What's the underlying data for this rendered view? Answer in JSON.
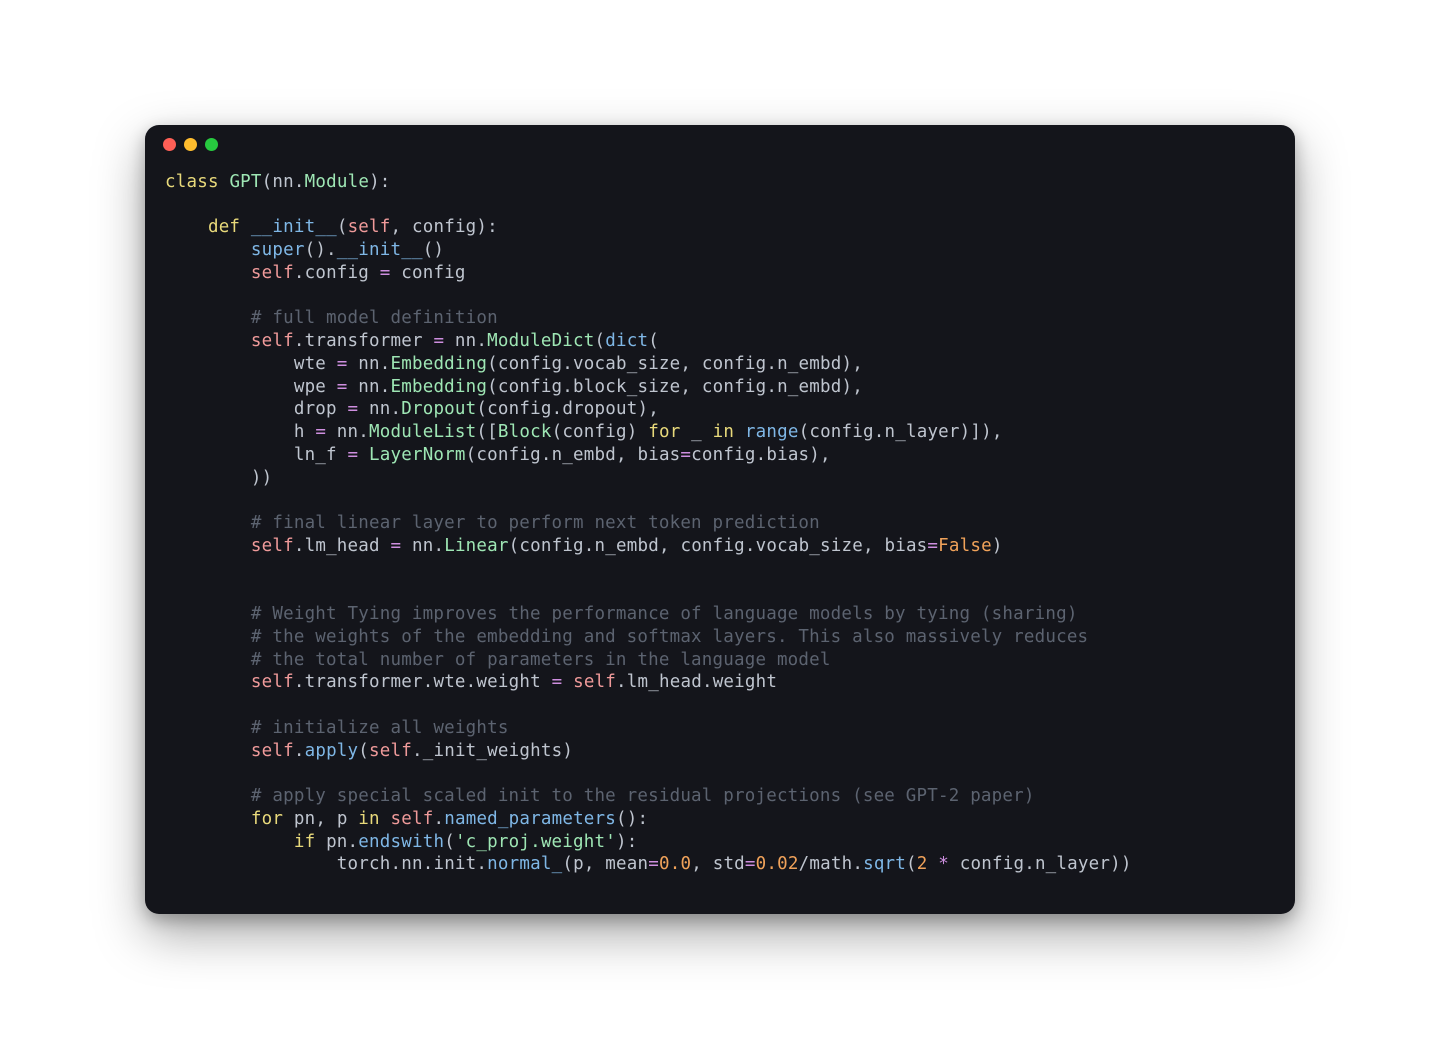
{
  "window": {
    "traffic_lights": [
      "close",
      "minimize",
      "zoom"
    ]
  },
  "code": {
    "lines": [
      [
        {
          "c": "tok-kw",
          "t": "class"
        },
        {
          "c": "tok-ident",
          "t": " "
        },
        {
          "c": "tok-cls",
          "t": "GPT"
        },
        {
          "c": "tok-punct",
          "t": "("
        },
        {
          "c": "tok-ident",
          "t": "nn"
        },
        {
          "c": "tok-punct",
          "t": "."
        },
        {
          "c": "tok-cls",
          "t": "Module"
        },
        {
          "c": "tok-punct",
          "t": "):"
        }
      ],
      [],
      [
        {
          "c": "tok-ident",
          "t": "    "
        },
        {
          "c": "tok-kw",
          "t": "def"
        },
        {
          "c": "tok-ident",
          "t": " "
        },
        {
          "c": "tok-func",
          "t": "__init__"
        },
        {
          "c": "tok-punct",
          "t": "("
        },
        {
          "c": "tok-self",
          "t": "self"
        },
        {
          "c": "tok-punct",
          "t": ", "
        },
        {
          "c": "tok-ident",
          "t": "config"
        },
        {
          "c": "tok-punct",
          "t": "):"
        }
      ],
      [
        {
          "c": "tok-ident",
          "t": "        "
        },
        {
          "c": "tok-func",
          "t": "super"
        },
        {
          "c": "tok-punct",
          "t": "()."
        },
        {
          "c": "tok-func",
          "t": "__init__"
        },
        {
          "c": "tok-punct",
          "t": "()"
        }
      ],
      [
        {
          "c": "tok-ident",
          "t": "        "
        },
        {
          "c": "tok-self",
          "t": "self"
        },
        {
          "c": "tok-punct",
          "t": "."
        },
        {
          "c": "tok-ident",
          "t": "config "
        },
        {
          "c": "tok-op",
          "t": "="
        },
        {
          "c": "tok-ident",
          "t": " config"
        }
      ],
      [],
      [
        {
          "c": "tok-ident",
          "t": "        "
        },
        {
          "c": "tok-cmt",
          "t": "# full model definition"
        }
      ],
      [
        {
          "c": "tok-ident",
          "t": "        "
        },
        {
          "c": "tok-self",
          "t": "self"
        },
        {
          "c": "tok-punct",
          "t": "."
        },
        {
          "c": "tok-ident",
          "t": "transformer "
        },
        {
          "c": "tok-op",
          "t": "="
        },
        {
          "c": "tok-ident",
          "t": " nn"
        },
        {
          "c": "tok-punct",
          "t": "."
        },
        {
          "c": "tok-cls",
          "t": "ModuleDict"
        },
        {
          "c": "tok-punct",
          "t": "("
        },
        {
          "c": "tok-func",
          "t": "dict"
        },
        {
          "c": "tok-punct",
          "t": "("
        }
      ],
      [
        {
          "c": "tok-ident",
          "t": "            wte "
        },
        {
          "c": "tok-op",
          "t": "="
        },
        {
          "c": "tok-ident",
          "t": " nn"
        },
        {
          "c": "tok-punct",
          "t": "."
        },
        {
          "c": "tok-cls",
          "t": "Embedding"
        },
        {
          "c": "tok-punct",
          "t": "("
        },
        {
          "c": "tok-ident",
          "t": "config"
        },
        {
          "c": "tok-punct",
          "t": "."
        },
        {
          "c": "tok-ident",
          "t": "vocab_size"
        },
        {
          "c": "tok-punct",
          "t": ", "
        },
        {
          "c": "tok-ident",
          "t": "config"
        },
        {
          "c": "tok-punct",
          "t": "."
        },
        {
          "c": "tok-ident",
          "t": "n_embd"
        },
        {
          "c": "tok-punct",
          "t": "),"
        }
      ],
      [
        {
          "c": "tok-ident",
          "t": "            wpe "
        },
        {
          "c": "tok-op",
          "t": "="
        },
        {
          "c": "tok-ident",
          "t": " nn"
        },
        {
          "c": "tok-punct",
          "t": "."
        },
        {
          "c": "tok-cls",
          "t": "Embedding"
        },
        {
          "c": "tok-punct",
          "t": "("
        },
        {
          "c": "tok-ident",
          "t": "config"
        },
        {
          "c": "tok-punct",
          "t": "."
        },
        {
          "c": "tok-ident",
          "t": "block_size"
        },
        {
          "c": "tok-punct",
          "t": ", "
        },
        {
          "c": "tok-ident",
          "t": "config"
        },
        {
          "c": "tok-punct",
          "t": "."
        },
        {
          "c": "tok-ident",
          "t": "n_embd"
        },
        {
          "c": "tok-punct",
          "t": "),"
        }
      ],
      [
        {
          "c": "tok-ident",
          "t": "            drop "
        },
        {
          "c": "tok-op",
          "t": "="
        },
        {
          "c": "tok-ident",
          "t": " nn"
        },
        {
          "c": "tok-punct",
          "t": "."
        },
        {
          "c": "tok-cls",
          "t": "Dropout"
        },
        {
          "c": "tok-punct",
          "t": "("
        },
        {
          "c": "tok-ident",
          "t": "config"
        },
        {
          "c": "tok-punct",
          "t": "."
        },
        {
          "c": "tok-ident",
          "t": "dropout"
        },
        {
          "c": "tok-punct",
          "t": "),"
        }
      ],
      [
        {
          "c": "tok-ident",
          "t": "            h "
        },
        {
          "c": "tok-op",
          "t": "="
        },
        {
          "c": "tok-ident",
          "t": " nn"
        },
        {
          "c": "tok-punct",
          "t": "."
        },
        {
          "c": "tok-cls",
          "t": "ModuleList"
        },
        {
          "c": "tok-punct",
          "t": "(["
        },
        {
          "c": "tok-cls",
          "t": "Block"
        },
        {
          "c": "tok-punct",
          "t": "("
        },
        {
          "c": "tok-ident",
          "t": "config"
        },
        {
          "c": "tok-punct",
          "t": ") "
        },
        {
          "c": "tok-kw",
          "t": "for"
        },
        {
          "c": "tok-ident",
          "t": " _ "
        },
        {
          "c": "tok-kw",
          "t": "in"
        },
        {
          "c": "tok-ident",
          "t": " "
        },
        {
          "c": "tok-func",
          "t": "range"
        },
        {
          "c": "tok-punct",
          "t": "("
        },
        {
          "c": "tok-ident",
          "t": "config"
        },
        {
          "c": "tok-punct",
          "t": "."
        },
        {
          "c": "tok-ident",
          "t": "n_layer"
        },
        {
          "c": "tok-punct",
          "t": ")]),"
        }
      ],
      [
        {
          "c": "tok-ident",
          "t": "            ln_f "
        },
        {
          "c": "tok-op",
          "t": "="
        },
        {
          "c": "tok-ident",
          "t": " "
        },
        {
          "c": "tok-cls",
          "t": "LayerNorm"
        },
        {
          "c": "tok-punct",
          "t": "("
        },
        {
          "c": "tok-ident",
          "t": "config"
        },
        {
          "c": "tok-punct",
          "t": "."
        },
        {
          "c": "tok-ident",
          "t": "n_embd"
        },
        {
          "c": "tok-punct",
          "t": ", "
        },
        {
          "c": "tok-ident",
          "t": "bias"
        },
        {
          "c": "tok-op",
          "t": "="
        },
        {
          "c": "tok-ident",
          "t": "config"
        },
        {
          "c": "tok-punct",
          "t": "."
        },
        {
          "c": "tok-ident",
          "t": "bias"
        },
        {
          "c": "tok-punct",
          "t": "),"
        }
      ],
      [
        {
          "c": "tok-ident",
          "t": "        "
        },
        {
          "c": "tok-punct",
          "t": "))"
        }
      ],
      [],
      [
        {
          "c": "tok-ident",
          "t": "        "
        },
        {
          "c": "tok-cmt",
          "t": "# final linear layer to perform next token prediction"
        }
      ],
      [
        {
          "c": "tok-ident",
          "t": "        "
        },
        {
          "c": "tok-self",
          "t": "self"
        },
        {
          "c": "tok-punct",
          "t": "."
        },
        {
          "c": "tok-ident",
          "t": "lm_head "
        },
        {
          "c": "tok-op",
          "t": "="
        },
        {
          "c": "tok-ident",
          "t": " nn"
        },
        {
          "c": "tok-punct",
          "t": "."
        },
        {
          "c": "tok-cls",
          "t": "Linear"
        },
        {
          "c": "tok-punct",
          "t": "("
        },
        {
          "c": "tok-ident",
          "t": "config"
        },
        {
          "c": "tok-punct",
          "t": "."
        },
        {
          "c": "tok-ident",
          "t": "n_embd"
        },
        {
          "c": "tok-punct",
          "t": ", "
        },
        {
          "c": "tok-ident",
          "t": "config"
        },
        {
          "c": "tok-punct",
          "t": "."
        },
        {
          "c": "tok-ident",
          "t": "vocab_size"
        },
        {
          "c": "tok-punct",
          "t": ", "
        },
        {
          "c": "tok-ident",
          "t": "bias"
        },
        {
          "c": "tok-op",
          "t": "="
        },
        {
          "c": "tok-const",
          "t": "False"
        },
        {
          "c": "tok-punct",
          "t": ")"
        }
      ],
      [],
      [],
      [
        {
          "c": "tok-ident",
          "t": "        "
        },
        {
          "c": "tok-cmt",
          "t": "# Weight Tying improves the performance of language models by tying (sharing)"
        }
      ],
      [
        {
          "c": "tok-ident",
          "t": "        "
        },
        {
          "c": "tok-cmt",
          "t": "# the weights of the embedding and softmax layers. This also massively reduces"
        }
      ],
      [
        {
          "c": "tok-ident",
          "t": "        "
        },
        {
          "c": "tok-cmt",
          "t": "# the total number of parameters in the language model"
        }
      ],
      [
        {
          "c": "tok-ident",
          "t": "        "
        },
        {
          "c": "tok-self",
          "t": "self"
        },
        {
          "c": "tok-punct",
          "t": "."
        },
        {
          "c": "tok-ident",
          "t": "transformer"
        },
        {
          "c": "tok-punct",
          "t": "."
        },
        {
          "c": "tok-ident",
          "t": "wte"
        },
        {
          "c": "tok-punct",
          "t": "."
        },
        {
          "c": "tok-ident",
          "t": "weight "
        },
        {
          "c": "tok-op",
          "t": "="
        },
        {
          "c": "tok-ident",
          "t": " "
        },
        {
          "c": "tok-self",
          "t": "self"
        },
        {
          "c": "tok-punct",
          "t": "."
        },
        {
          "c": "tok-ident",
          "t": "lm_head"
        },
        {
          "c": "tok-punct",
          "t": "."
        },
        {
          "c": "tok-ident",
          "t": "weight"
        }
      ],
      [],
      [
        {
          "c": "tok-ident",
          "t": "        "
        },
        {
          "c": "tok-cmt",
          "t": "# initialize all weights"
        }
      ],
      [
        {
          "c": "tok-ident",
          "t": "        "
        },
        {
          "c": "tok-self",
          "t": "self"
        },
        {
          "c": "tok-punct",
          "t": "."
        },
        {
          "c": "tok-func",
          "t": "apply"
        },
        {
          "c": "tok-punct",
          "t": "("
        },
        {
          "c": "tok-self",
          "t": "self"
        },
        {
          "c": "tok-punct",
          "t": "."
        },
        {
          "c": "tok-ident",
          "t": "_init_weights"
        },
        {
          "c": "tok-punct",
          "t": ")"
        }
      ],
      [],
      [
        {
          "c": "tok-ident",
          "t": "        "
        },
        {
          "c": "tok-cmt",
          "t": "# apply special scaled init to the residual projections (see GPT-2 paper)"
        }
      ],
      [
        {
          "c": "tok-ident",
          "t": "        "
        },
        {
          "c": "tok-kw",
          "t": "for"
        },
        {
          "c": "tok-ident",
          "t": " pn"
        },
        {
          "c": "tok-punct",
          "t": ", "
        },
        {
          "c": "tok-ident",
          "t": "p "
        },
        {
          "c": "tok-kw",
          "t": "in"
        },
        {
          "c": "tok-ident",
          "t": " "
        },
        {
          "c": "tok-self",
          "t": "self"
        },
        {
          "c": "tok-punct",
          "t": "."
        },
        {
          "c": "tok-func",
          "t": "named_parameters"
        },
        {
          "c": "tok-punct",
          "t": "():"
        }
      ],
      [
        {
          "c": "tok-ident",
          "t": "            "
        },
        {
          "c": "tok-kw",
          "t": "if"
        },
        {
          "c": "tok-ident",
          "t": " pn"
        },
        {
          "c": "tok-punct",
          "t": "."
        },
        {
          "c": "tok-func",
          "t": "endswith"
        },
        {
          "c": "tok-punct",
          "t": "("
        },
        {
          "c": "tok-str",
          "t": "'c_proj.weight'"
        },
        {
          "c": "tok-punct",
          "t": "):"
        }
      ],
      [
        {
          "c": "tok-ident",
          "t": "                torch"
        },
        {
          "c": "tok-punct",
          "t": "."
        },
        {
          "c": "tok-ident",
          "t": "nn"
        },
        {
          "c": "tok-punct",
          "t": "."
        },
        {
          "c": "tok-ident",
          "t": "init"
        },
        {
          "c": "tok-punct",
          "t": "."
        },
        {
          "c": "tok-func",
          "t": "normal_"
        },
        {
          "c": "tok-punct",
          "t": "("
        },
        {
          "c": "tok-ident",
          "t": "p"
        },
        {
          "c": "tok-punct",
          "t": ", "
        },
        {
          "c": "tok-ident",
          "t": "mean"
        },
        {
          "c": "tok-op",
          "t": "="
        },
        {
          "c": "tok-num",
          "t": "0.0"
        },
        {
          "c": "tok-punct",
          "t": ", "
        },
        {
          "c": "tok-ident",
          "t": "std"
        },
        {
          "c": "tok-op",
          "t": "="
        },
        {
          "c": "tok-num",
          "t": "0.02"
        },
        {
          "c": "tok-punct",
          "t": "/"
        },
        {
          "c": "tok-ident",
          "t": "math"
        },
        {
          "c": "tok-punct",
          "t": "."
        },
        {
          "c": "tok-func",
          "t": "sqrt"
        },
        {
          "c": "tok-punct",
          "t": "("
        },
        {
          "c": "tok-num",
          "t": "2"
        },
        {
          "c": "tok-ident",
          "t": " "
        },
        {
          "c": "tok-op",
          "t": "*"
        },
        {
          "c": "tok-ident",
          "t": " config"
        },
        {
          "c": "tok-punct",
          "t": "."
        },
        {
          "c": "tok-ident",
          "t": "n_layer"
        },
        {
          "c": "tok-punct",
          "t": "))"
        }
      ]
    ]
  }
}
